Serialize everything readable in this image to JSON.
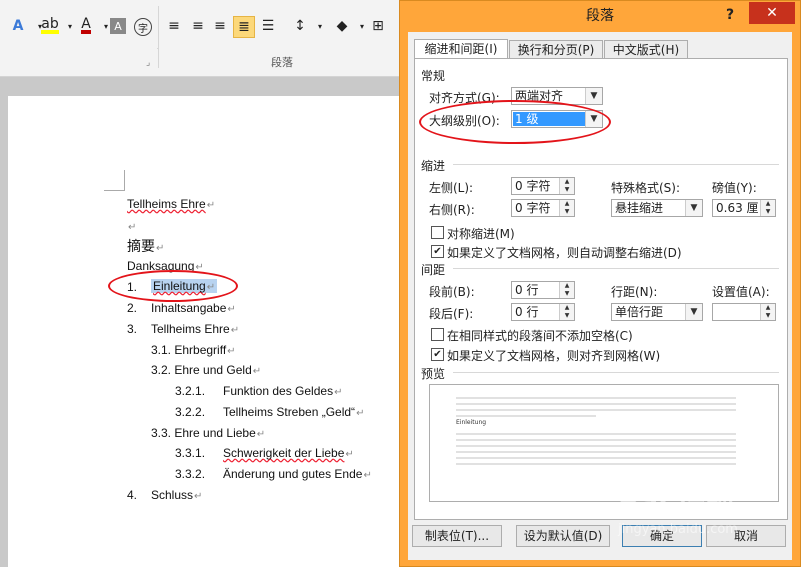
{
  "ribbon": {
    "group_label": "段落",
    "font_color_hex": "#c00000",
    "highlight_hex": "#ffff00"
  },
  "document": {
    "lines": [
      {
        "num": "",
        "text": "Tellheims Ehre"
      },
      {
        "num": "",
        "text": ""
      },
      {
        "num": "",
        "text": "摘要"
      },
      {
        "num": "",
        "text": "Danksagung"
      },
      {
        "num": "1.",
        "text": "Einleitung"
      },
      {
        "num": "2.",
        "text": "Inhaltsangabe"
      },
      {
        "num": "3.",
        "text": "Tellheims Ehre"
      },
      {
        "num": "3.1.",
        "text": "Ehrbegriff"
      },
      {
        "num": "3.2.",
        "text": "Ehre und Geld"
      },
      {
        "num": "3.2.1.",
        "text": "Funktion des Geldes"
      },
      {
        "num": "3.2.2.",
        "text": "Tellheims Streben „Geld“"
      },
      {
        "num": "3.3.",
        "text": "Ehre und Liebe"
      },
      {
        "num": "3.3.1.",
        "text": "Schwerigkeit der Liebe"
      },
      {
        "num": "3.3.2.",
        "text": "Änderung und gutes Ende"
      },
      {
        "num": "4.",
        "text": "Schluss"
      }
    ],
    "para_mark": "↵"
  },
  "dialog": {
    "title": "段落",
    "help": "?",
    "close": "✕",
    "tabs": [
      "缩进和间距(I)",
      "换行和分页(P)",
      "中文版式(H)"
    ],
    "general": {
      "section": "常规",
      "alignment_label": "对齐方式(G):",
      "alignment_value": "两端对齐",
      "outline_label": "大纲级别(O):",
      "outline_value": "1 级"
    },
    "indent": {
      "section": "缩进",
      "left_label": "左侧(L):",
      "left_value": "0 字符",
      "right_label": "右侧(R):",
      "right_value": "0 字符",
      "special_label": "特殊格式(S):",
      "special_value": "悬挂缩进",
      "by_label": "磅值(Y):",
      "by_value": "0.63 厘",
      "mirror_label": "对称缩进(M)",
      "mirror_checked": false,
      "auto_label": "如果定义了文档网格，则自动调整右缩进(D)",
      "auto_checked": true
    },
    "spacing": {
      "section": "间距",
      "before_label": "段前(B):",
      "before_value": "0 行",
      "after_label": "段后(F):",
      "after_value": "0 行",
      "line_label": "行距(N):",
      "line_value": "单倍行距",
      "at_label": "设置值(A):",
      "at_value": "",
      "nospace_label": "在相同样式的段落间不添加空格(C)",
      "nospace_checked": false,
      "grid_label": "如果定义了文档网格，则对齐到网格(W)",
      "grid_checked": true
    },
    "preview": {
      "section": "预览",
      "sample_text": "Einleitung"
    },
    "buttons": {
      "tabs": "制表位(T)...",
      "default": "设为默认值(D)",
      "ok": "确定",
      "cancel": "取消"
    }
  },
  "watermark": {
    "text": "Bai 经验",
    "sub": "jingyan.baidu.com"
  },
  "annotation_color": "#e3141a"
}
